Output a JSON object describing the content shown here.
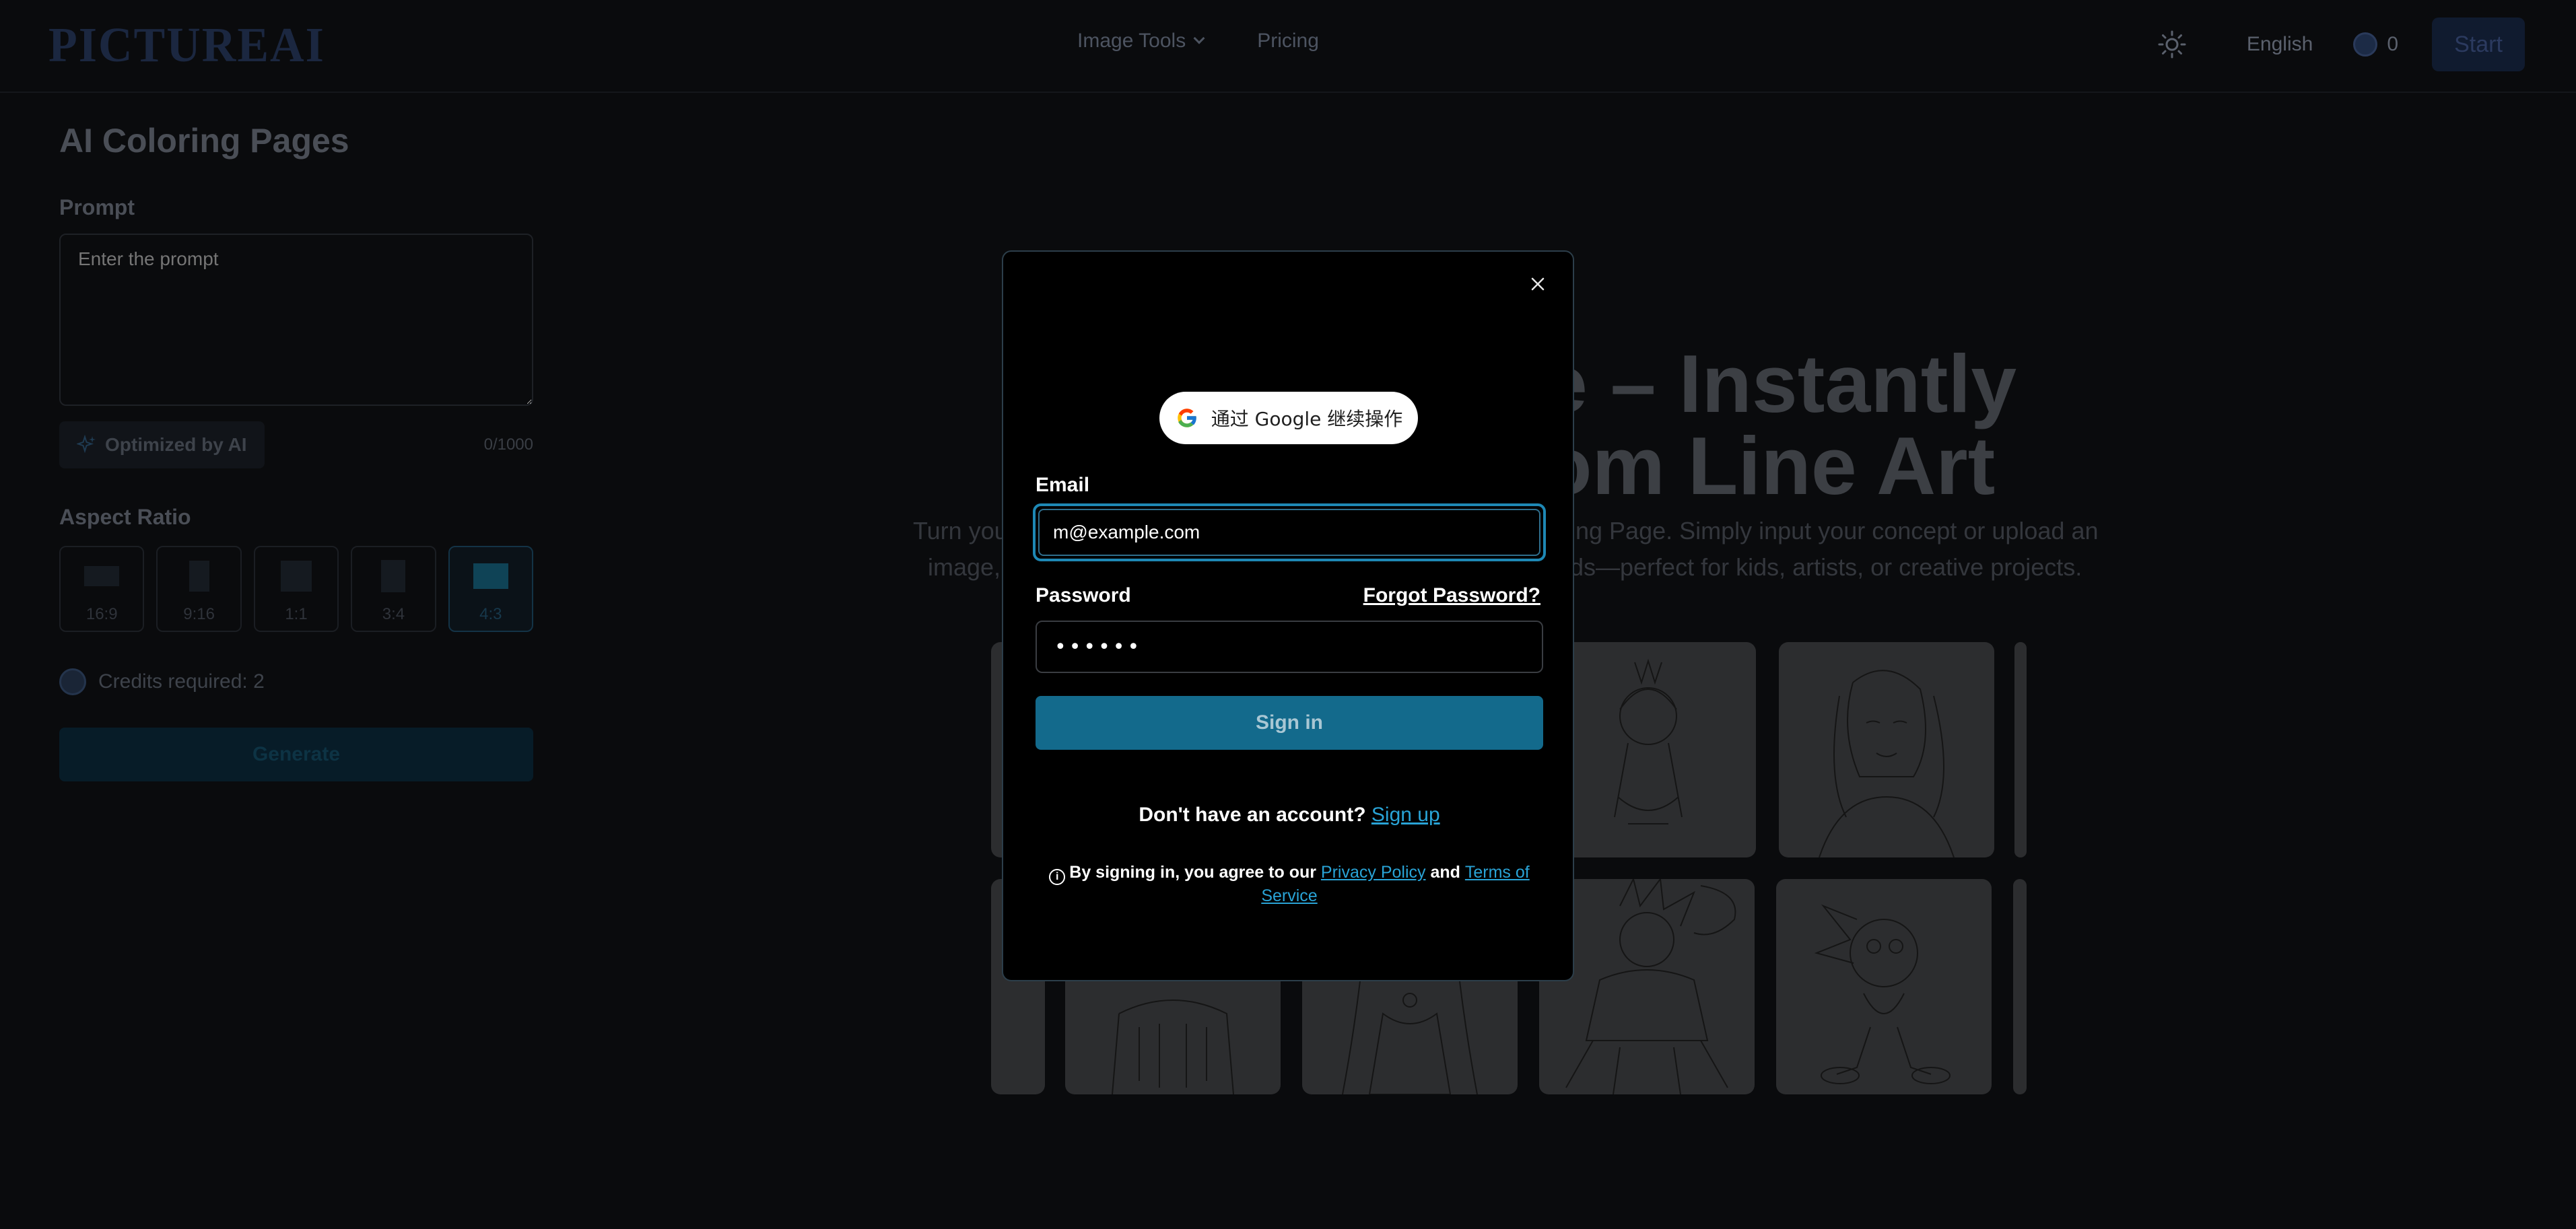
{
  "header": {
    "logo": "PICTUREAI",
    "nav": [
      {
        "label": "Image Tools"
      },
      {
        "label": "Pricing"
      }
    ],
    "language": "English",
    "credits": "0",
    "start_label": "Start"
  },
  "left_panel": {
    "title": "AI Coloring Pages",
    "prompt_label": "Prompt",
    "prompt_placeholder": "Enter the prompt",
    "optimize_label": "Optimized by AI",
    "counter": "0/1000",
    "aspect_label": "Aspect Ratio",
    "aspect_ratios": [
      "16:9",
      "9:16",
      "1:1",
      "3:4",
      "4:3"
    ],
    "selected_aspect": "4:3",
    "credits_required": "Credits required: 2",
    "generate_label": "Generate"
  },
  "hero": {
    "title_line1": "e – Instantly",
    "title_line2": "om Line Art",
    "sub_line1_left": "Turn you",
    "sub_line1_right": "ing Page. Simply input your concept or upload an",
    "sub_line2_left": "image,",
    "sub_line2_right": "ds—perfect for kids, artists, or creative projects."
  },
  "modal": {
    "google_label": "通过 Google 继续操作",
    "email_label": "Email",
    "email_value": "m@example.com",
    "password_label": "Password",
    "forgot_label": "Forgot Password?",
    "password_value": "••••••",
    "signin_label": "Sign in",
    "no_account_text": "Don't have an account?",
    "signup_label": "Sign up",
    "terms_prefix": "By signing in, you agree to our",
    "privacy_label": "Privacy Policy",
    "and_text": "and",
    "tos_label": "Terms of Service"
  },
  "colors": {
    "background": "#0a0b0d",
    "accent": "#136a8c",
    "link": "#29a3d6",
    "focus_ring": "#1e88b5"
  }
}
